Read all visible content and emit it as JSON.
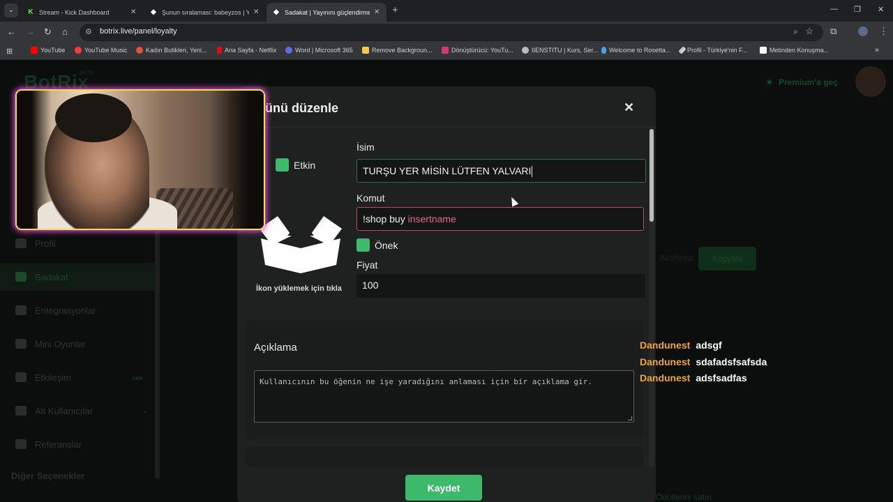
{
  "browser": {
    "tabs": [
      {
        "title": "Stream - Kick Dashboard",
        "favicon": "kick-icon",
        "active": false
      },
      {
        "title": "Şunun sıralaması: babeyzos | Yay",
        "favicon": "botrix-icon",
        "active": false
      },
      {
        "title": "Sadakat | Yayınını güçlendirmek",
        "favicon": "botrix-icon",
        "active": true
      }
    ],
    "new_tab": "+",
    "url": "botrix.live/panel/loyalty",
    "bookmarks": [
      {
        "label": "YouTube",
        "color": "#ff0000"
      },
      {
        "label": "YouTube Music",
        "color": "#ff3b3b"
      },
      {
        "label": "Kadın Butikleri, Yeni...",
        "color": "#e0503a"
      },
      {
        "label": "Ana Sayfa - Netflix",
        "color": "#e50914"
      },
      {
        "label": "Word | Microsoft 365",
        "color": "#5b6ee8"
      },
      {
        "label": "Remove Backgroun...",
        "color": "#f2c94c"
      },
      {
        "label": "Dönüştürücü: YouTu...",
        "color": "#d63a6a"
      },
      {
        "label": "IIENSTITU | Kurs, Ser...",
        "color": "#bbbbbb"
      },
      {
        "label": "Welcome to Rosetta...",
        "color": "#4aa3e8"
      },
      {
        "label": "Profil - Türkiye'nin F...",
        "color": "#cccccc"
      },
      {
        "label": "Metinden Konuşma...",
        "color": "#ffffff"
      }
    ]
  },
  "app": {
    "logo": "BotRix",
    "logo_badge": "BETA",
    "premium": "Premium'a geç",
    "sidebar": [
      {
        "label": "Profil",
        "active": false
      },
      {
        "label": "Sadakat",
        "active": true
      },
      {
        "label": "Entegrasyonlar",
        "active": false
      },
      {
        "label": "Mini Oyunlar",
        "active": false
      },
      {
        "label": "Etkileşim",
        "active": false,
        "badge": "new"
      },
      {
        "label": "Alt Kullanıcılar",
        "active": false
      },
      {
        "label": "Referanslar",
        "active": false
      }
    ],
    "sidebar_section": "Diğer Seçenekler",
    "bg_copy_button": "Kopyala",
    "bg_faded_text": "Aktifleştir",
    "bg_bottom_text": "Ödüllerini satın"
  },
  "modal": {
    "title": "ünü düzenle",
    "enabled_label": "Etkin",
    "upload_hint": "İkon yüklemek için tıkla",
    "name_label": "İsim",
    "name_value": "TURŞU YER MİSİN LÜTFEN YALVARI",
    "command_label": "Komut",
    "command_prefix": "!shop buy ",
    "command_arg": "insertname",
    "prefix_label": "Önek",
    "price_label": "Fiyat",
    "price_value": "100",
    "description_label": "Açıklama",
    "description_placeholder": "Kullanıcının bu öğenin ne işe yaradığını anlaması için bir açıklama gir.",
    "save_button": "Kaydet"
  },
  "chat": [
    {
      "user": "Dandunest",
      "message": "adsgf"
    },
    {
      "user": "Dandunest",
      "message": "sdafadsfsafsda"
    },
    {
      "user": "Dandunest",
      "message": "adsfsadfas"
    }
  ],
  "colors": {
    "accent": "#3cb96a",
    "chat_user": "#f0a534",
    "error_border": "#b94a61",
    "webcam_border": "#f0e04d",
    "webcam_glow": "#e04dd5"
  }
}
